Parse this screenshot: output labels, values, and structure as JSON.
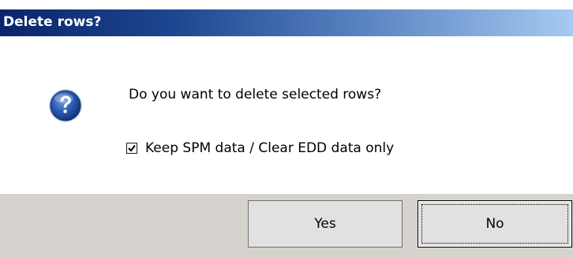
{
  "dialog": {
    "title": "Delete rows?",
    "message": "Do you want to delete selected rows?",
    "icon": "question-icon",
    "checkbox": {
      "label": "Keep SPM data / Clear EDD data only",
      "checked": true
    },
    "buttons": {
      "yes_label": "Yes",
      "no_label": "No"
    }
  },
  "colors": {
    "title_gradient_start": "#0a246a",
    "title_gradient_end": "#a6caf0",
    "button_bar": "#d6d3ce",
    "icon_blue": "#1e4a9a"
  }
}
